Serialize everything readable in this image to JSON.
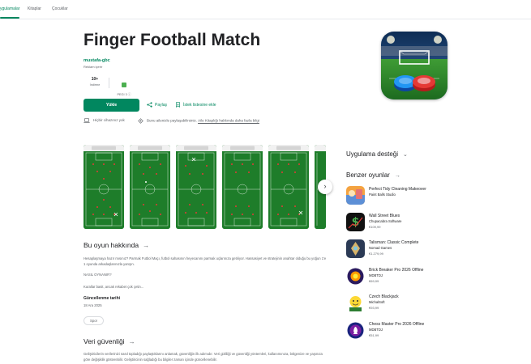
{
  "nav": {
    "tabs": [
      {
        "label": "ygulamalar",
        "active": true
      },
      {
        "label": "Kitaplar",
        "active": false
      },
      {
        "label": "Çocuklar",
        "active": false
      }
    ]
  },
  "app": {
    "title": "Finger Football Match",
    "developer": "mustafa-gbc",
    "iap_note": "Reklam içerir",
    "downloads_value": "10+",
    "downloads_label": "İndirme",
    "rating_label": "PEGI 3 ⓘ",
    "install_label": "Yükle",
    "share_label": "Paylaş",
    "wishlist_label": "İstek listesine ekle",
    "device_note": "Hiçbir cihazınız yok",
    "family_note": "Bunu ailenizle paylaşabilirsiniz.",
    "family_link": "Aile Kitaplığı hakkında daha fazla bilgi"
  },
  "colors": {
    "accent": "#01875f",
    "pitch": "#1e7d2a",
    "pitch_light": "#2e9a3a"
  },
  "about": {
    "heading": "Bu oyun hakkında",
    "p1": "Hesaplaşmaya hazır mısınız? Parmak Futbol Maçı, futbol sahasının heyecanını parmak uçlarınıza getiriyor. Hassasiyet ve stratejinin anahtar olduğu bu yoğun 1'e 1 oyunda arkadaşlarınızla yarışın.",
    "p2": "NASIL OYNANIR?",
    "p3": "Kurallar basit, ancak rekabet çok çetin...",
    "updated_label": "Güncellenme tarihi",
    "updated_value": "18 Ara 2025",
    "chip": "Spor"
  },
  "safety": {
    "heading": "Veri güvenliği",
    "text": "Geliştiricilerin verilerinizi nasıl topladığı paylaştıklarını anlamak, güvenliğin ilk adımıdır. Veri gizliliği ve güvenliği yöntemleri, kullanımınıza, bölgenize ve yaşınıza göre değişiklik gösterebilir. Geliştiricinin sağladığı bu bilgiler zaman içinde güncellenebilir."
  },
  "sidebar": {
    "support_heading": "Uygulama desteği",
    "similar_heading": "Benzer oyunlar",
    "similar": [
      {
        "title": "Perfect Tidy Cleaning Makeover",
        "dev": "Paint Balls Studio",
        "price": "",
        "icon": "cleaning-game-icon"
      },
      {
        "title": "Wall Street Blues",
        "dev": "Chupacabra Software",
        "price": "€109,99",
        "icon": "stock-chart-icon"
      },
      {
        "title": "Talisman: Classic Complete",
        "dev": "Nomad Games",
        "price": "€1.279,99",
        "icon": "talisman-icon"
      },
      {
        "title": "Brick Breaker Pro 2026 Offline",
        "dev": "MDBTDJ",
        "price": "€69,99",
        "icon": "brick-breaker-icon"
      },
      {
        "title": "Czech Blackjack",
        "dev": "MichalSoft",
        "price": "€93,99",
        "icon": "blackjack-icon"
      },
      {
        "title": "Chess Master Pro 2026 Offline",
        "dev": "MDBTDJ",
        "price": "€51,99",
        "icon": "chess-icon"
      }
    ]
  }
}
